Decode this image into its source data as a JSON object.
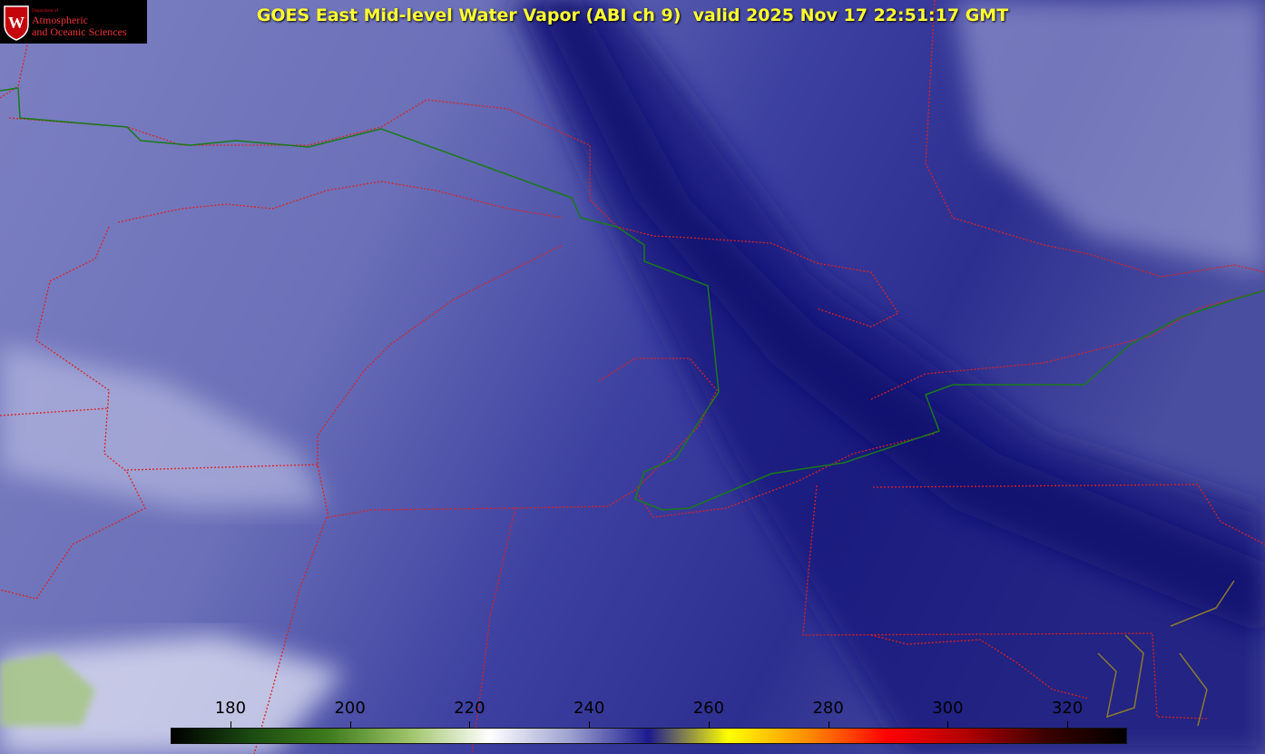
{
  "title": "GOES East Mid-level Water Vapor (ABI ch 9)  valid 2025 Nov 17 22:51:17 GMT",
  "logo": {
    "department": "Department of",
    "line1": "Atmospheric",
    "line2": "and Oceanic Sciences",
    "seal_letter": "W"
  },
  "colorbar": {
    "ticks": [
      "180",
      "200",
      "220",
      "240",
      "260",
      "280",
      "300",
      "320"
    ],
    "min": 170,
    "max": 330,
    "stops": [
      "#000000",
      "#1a4a10",
      "#3f7d1e",
      "#9fc46a",
      "#ffffff",
      "#9ea2d0",
      "#1c1a8f",
      "#ffff00",
      "#ff8c00",
      "#ff0000",
      "#b00000",
      "#3a0000",
      "#000000"
    ]
  },
  "colors": {
    "state_borders": "#e02020",
    "intl_border": "#1a7a1a",
    "water_vapor_bg": "#5b60ab"
  }
}
